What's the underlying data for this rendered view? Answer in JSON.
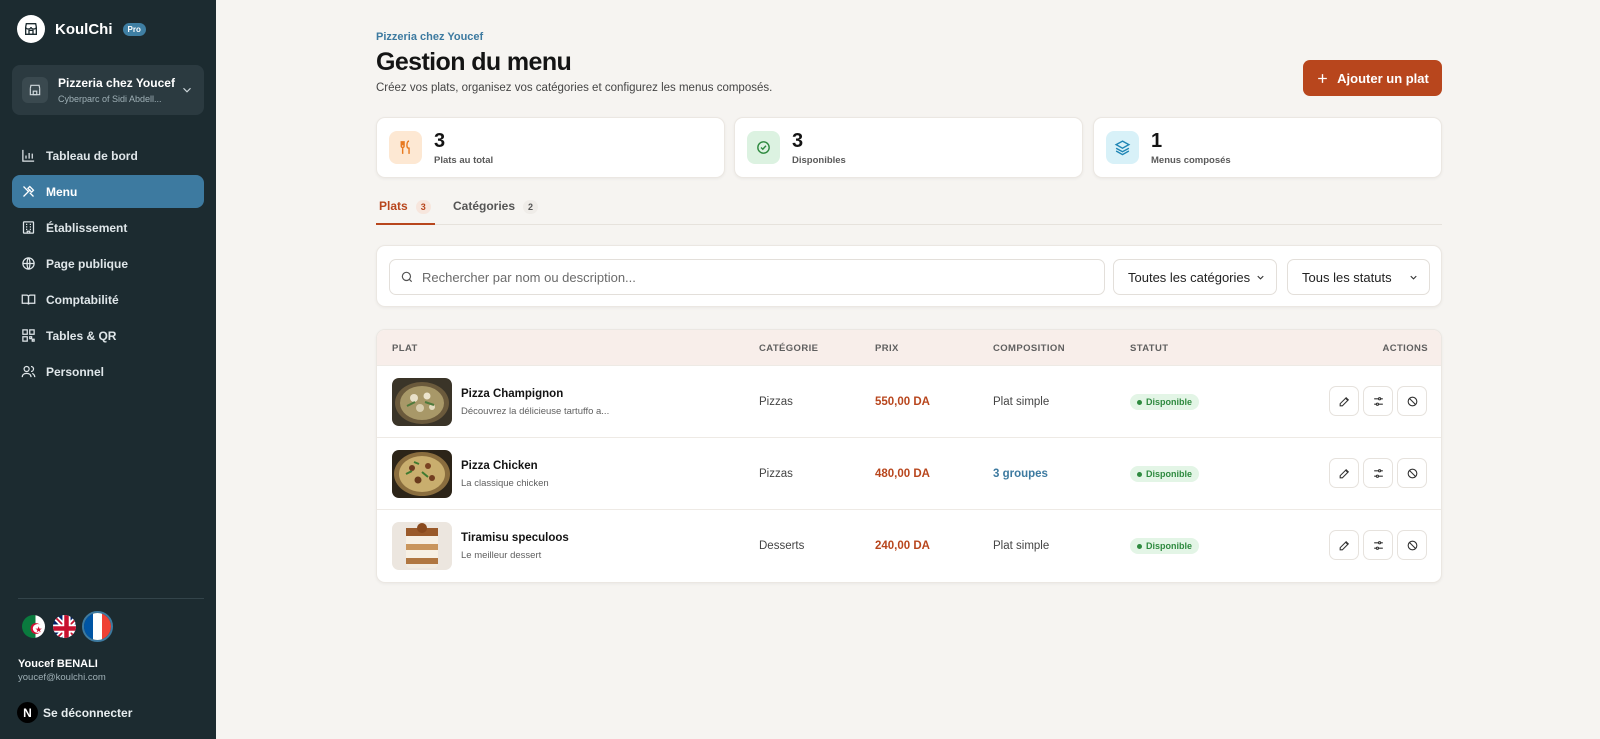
{
  "brand": {
    "name": "KoulChi",
    "badge": "Pro"
  },
  "restaurant": {
    "name": "Pizzeria chez Youcef",
    "address": "Cyberparc of Sidi Abdell..."
  },
  "nav": [
    {
      "label": "Tableau de bord",
      "icon": "bar-chart-icon"
    },
    {
      "label": "Menu",
      "icon": "utensils-icon",
      "active": true
    },
    {
      "label": "Établissement",
      "icon": "building-icon"
    },
    {
      "label": "Page publique",
      "icon": "globe-icon"
    },
    {
      "label": "Comptabilité",
      "icon": "book-icon"
    },
    {
      "label": "Tables & QR",
      "icon": "qr-code-icon"
    },
    {
      "label": "Personnel",
      "icon": "users-icon"
    }
  ],
  "languages": [
    "flag-algeria",
    "flag-uk",
    "flag-france"
  ],
  "user": {
    "name": "Youcef BENALI",
    "email": "youcef@koulchi.com",
    "avatar_initial": "N",
    "logout_label": "Se déconnecter"
  },
  "header": {
    "breadcrumb": "Pizzeria chez Youcef",
    "title": "Gestion du menu",
    "subtitle": "Créez vos plats, organisez vos catégories et configurez les menus composés.",
    "add_button": "Ajouter un plat"
  },
  "stats": [
    {
      "value": "3",
      "label": "Plats au total",
      "icon": "fork-knife-icon",
      "color": "#f28b30"
    },
    {
      "value": "3",
      "label": "Disponibles",
      "icon": "check-circle-icon",
      "color": "#2e8a3f"
    },
    {
      "value": "1",
      "label": "Menus composés",
      "icon": "layers-icon",
      "color": "#1f86b5"
    }
  ],
  "tabs": [
    {
      "label": "Plats",
      "count": "3",
      "active": true
    },
    {
      "label": "Catégories",
      "count": "2",
      "active": false
    }
  ],
  "filters": {
    "search_placeholder": "Rechercher par nom ou description...",
    "category": "Toutes les catégories",
    "status": "Tous les statuts"
  },
  "table": {
    "headers": {
      "dish": "PLAT",
      "category": "CATÉGORIE",
      "price": "PRIX",
      "composition": "COMPOSITION",
      "status": "STATUT",
      "actions": "ACTIONS"
    },
    "rows": [
      {
        "name": "Pizza Champignon",
        "description": "Découvrez la délicieuse tartuffo a...",
        "category": "Pizzas",
        "price": "550,00 DA",
        "composition": "Plat simple",
        "composition_is_link": false,
        "status": "Disponible"
      },
      {
        "name": "Pizza Chicken",
        "description": "La classique chicken",
        "category": "Pizzas",
        "price": "480,00 DA",
        "composition": "3 groupes",
        "composition_is_link": true,
        "status": "Disponible"
      },
      {
        "name": "Tiramisu speculoos",
        "description": "Le meilleur dessert",
        "category": "Desserts",
        "price": "240,00 DA",
        "composition": "Plat simple",
        "composition_is_link": false,
        "status": "Disponible"
      }
    ]
  },
  "colors": {
    "accent": "#b8461d",
    "sidebar_bg": "#1c2b30",
    "nav_active": "#3d7aa0",
    "status_green": "#2e8a3f"
  }
}
